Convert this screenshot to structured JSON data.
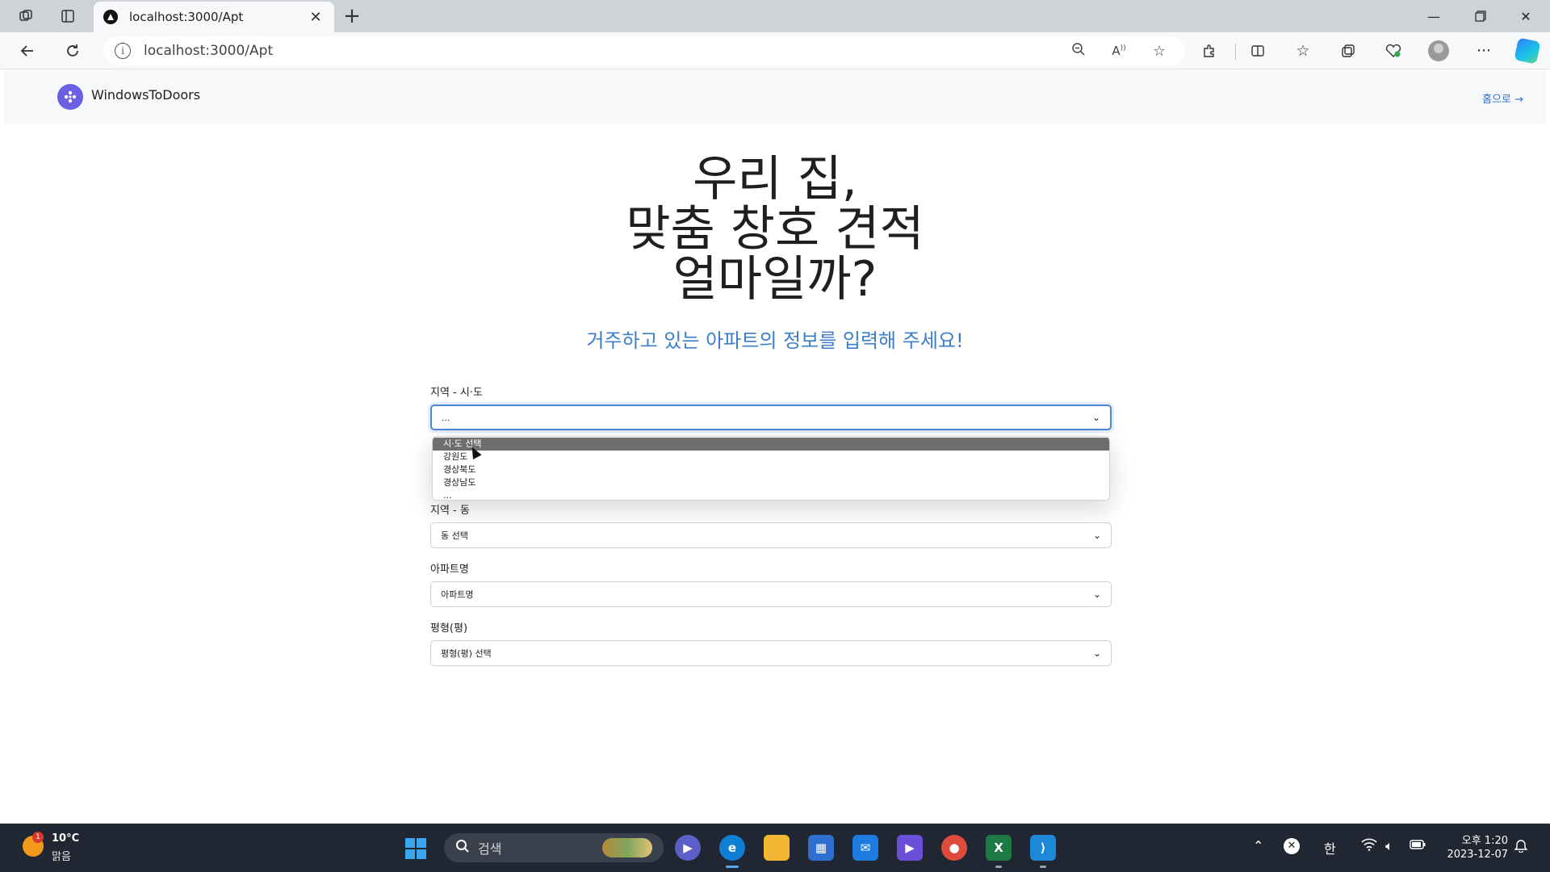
{
  "browser": {
    "tab_title": "localhost:3000/Apt",
    "url": "localhost:3000/Apt",
    "icons": [
      "workspaces-icon",
      "tab-actions-icon",
      "back-icon",
      "refresh-icon",
      "info-icon",
      "zoom-icon",
      "read-aloud-icon",
      "favorite-star-icon",
      "extensions-icon",
      "split-screen-icon",
      "favorites-icon",
      "collections-icon",
      "browser-essentials-icon",
      "profile-icon",
      "more-icon",
      "copilot-icon"
    ]
  },
  "header": {
    "brand": "WindowsToDoors",
    "home_link": "홈으로 →"
  },
  "hero": {
    "line1": "우리 집,",
    "line2": "맞춤 창호 견적",
    "line3": "얼마일까?",
    "subtitle": "거주하고 있는 아파트의 정보를 입력해 주세요!"
  },
  "form": {
    "sido_label": "지역 - 시·도",
    "sido_value": "...",
    "sido_options": [
      "시·도 선택",
      "강원도",
      "경상북도",
      "경상남도",
      "..."
    ],
    "dong_label": "지역 - 동",
    "dong_value": "동 선택",
    "apt_label": "아파트명",
    "apt_value": "아파트명",
    "size_label": "평형(평)",
    "size_value": "평형(평) 선택"
  },
  "taskbar": {
    "weather_temp": "10°C",
    "weather_desc": "맑음",
    "weather_badge": "1",
    "search_placeholder": "검색",
    "ime": "한",
    "time": "오후 1:20",
    "date": "2023-12-07"
  },
  "colors": {
    "accent": "#3b7ec9",
    "logo": "#6b5fe6",
    "focus": "#4b86d4"
  }
}
